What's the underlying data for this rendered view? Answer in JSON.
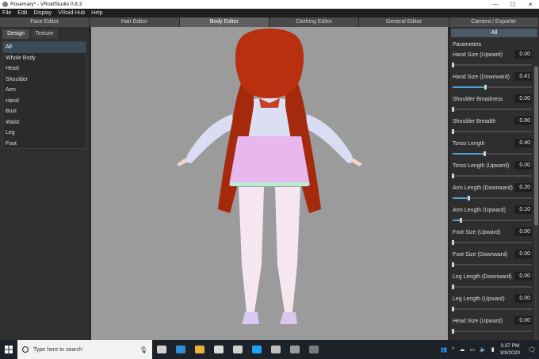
{
  "window": {
    "title": "Rosemary* - VRoidStudio 0.8.3",
    "controls": [
      "—",
      "☐",
      "✕"
    ]
  },
  "menu": [
    "File",
    "Edit",
    "Display",
    "VRoid Hub",
    "Help"
  ],
  "editor_tabs": [
    {
      "label": "Face Editor",
      "active": false
    },
    {
      "label": "Hair Editor",
      "active": false
    },
    {
      "label": "Body Editor",
      "active": true
    },
    {
      "label": "Clothing Editor",
      "active": false
    },
    {
      "label": "General Editor",
      "active": false
    },
    {
      "label": "Camera / Exporter",
      "active": false
    }
  ],
  "left_panel": {
    "subtabs": [
      {
        "label": "Design",
        "active": true
      },
      {
        "label": "Texture",
        "active": false
      }
    ],
    "categories": [
      {
        "label": "All",
        "selected": true
      },
      {
        "label": "Whole Body",
        "selected": false
      },
      {
        "label": "Head",
        "selected": false
      },
      {
        "label": "Shoulder",
        "selected": false
      },
      {
        "label": "Arm",
        "selected": false
      },
      {
        "label": "Hand",
        "selected": false
      },
      {
        "label": "Bust",
        "selected": false
      },
      {
        "label": "Waist",
        "selected": false
      },
      {
        "label": "Leg",
        "selected": false
      },
      {
        "label": "Foot",
        "selected": false
      }
    ]
  },
  "right_panel": {
    "tab": "All",
    "section_title": "Parameters",
    "params": [
      {
        "label": "Hand Size (Upward)",
        "value": "0.00",
        "fraction": 0.0
      },
      {
        "label": "Hand Size (Downward)",
        "value": "0.41",
        "fraction": 0.41
      },
      {
        "label": "Shoulder Broadness",
        "value": "0.00",
        "fraction": 0.0
      },
      {
        "label": "Shoulder Breadth",
        "value": "0.00",
        "fraction": 0.0
      },
      {
        "label": "Torso Length",
        "value": "0.40",
        "fraction": 0.4
      },
      {
        "label": "Torso Length (Upward)",
        "value": "0.00",
        "fraction": 0.0
      },
      {
        "label": "Arm Length (Downward)",
        "value": "0.20",
        "fraction": 0.2
      },
      {
        "label": "Arm Length (Upward)",
        "value": "0.10",
        "fraction": 0.1
      },
      {
        "label": "Foot Size (Upward)",
        "value": "0.00",
        "fraction": 0.0
      },
      {
        "label": "Foot Size (Downward)",
        "value": "0.00",
        "fraction": 0.0
      },
      {
        "label": "Leg Length (Downward)",
        "value": "0.00",
        "fraction": 0.0
      },
      {
        "label": "Leg Length (Upward)",
        "value": "0.00",
        "fraction": 0.0
      },
      {
        "label": "Head Size (Upward)",
        "value": "0.00",
        "fraction": 0.0
      }
    ]
  },
  "taskbar": {
    "search_placeholder": "Type here to search",
    "time": "3:37 PM",
    "date": "3/9/2020",
    "apps": [
      {
        "icon": "task-view-icon",
        "color": "#d0d0d0"
      },
      {
        "icon": "edge-icon",
        "color": "#2d8fd6"
      },
      {
        "icon": "file-explorer-icon",
        "color": "#e8b33a"
      },
      {
        "icon": "store-icon",
        "color": "#d9d9d9"
      },
      {
        "icon": "mail-icon",
        "color": "#d0d0d0"
      },
      {
        "icon": "twitter-icon",
        "color": "#1da1f2"
      },
      {
        "icon": "photos-icon",
        "color": "#bfbfbf"
      },
      {
        "icon": "app-icon",
        "color": "#9a9a9a"
      },
      {
        "icon": "vroid-icon",
        "color": "#7a7a7a"
      }
    ],
    "accent": "#4aa3d8"
  }
}
